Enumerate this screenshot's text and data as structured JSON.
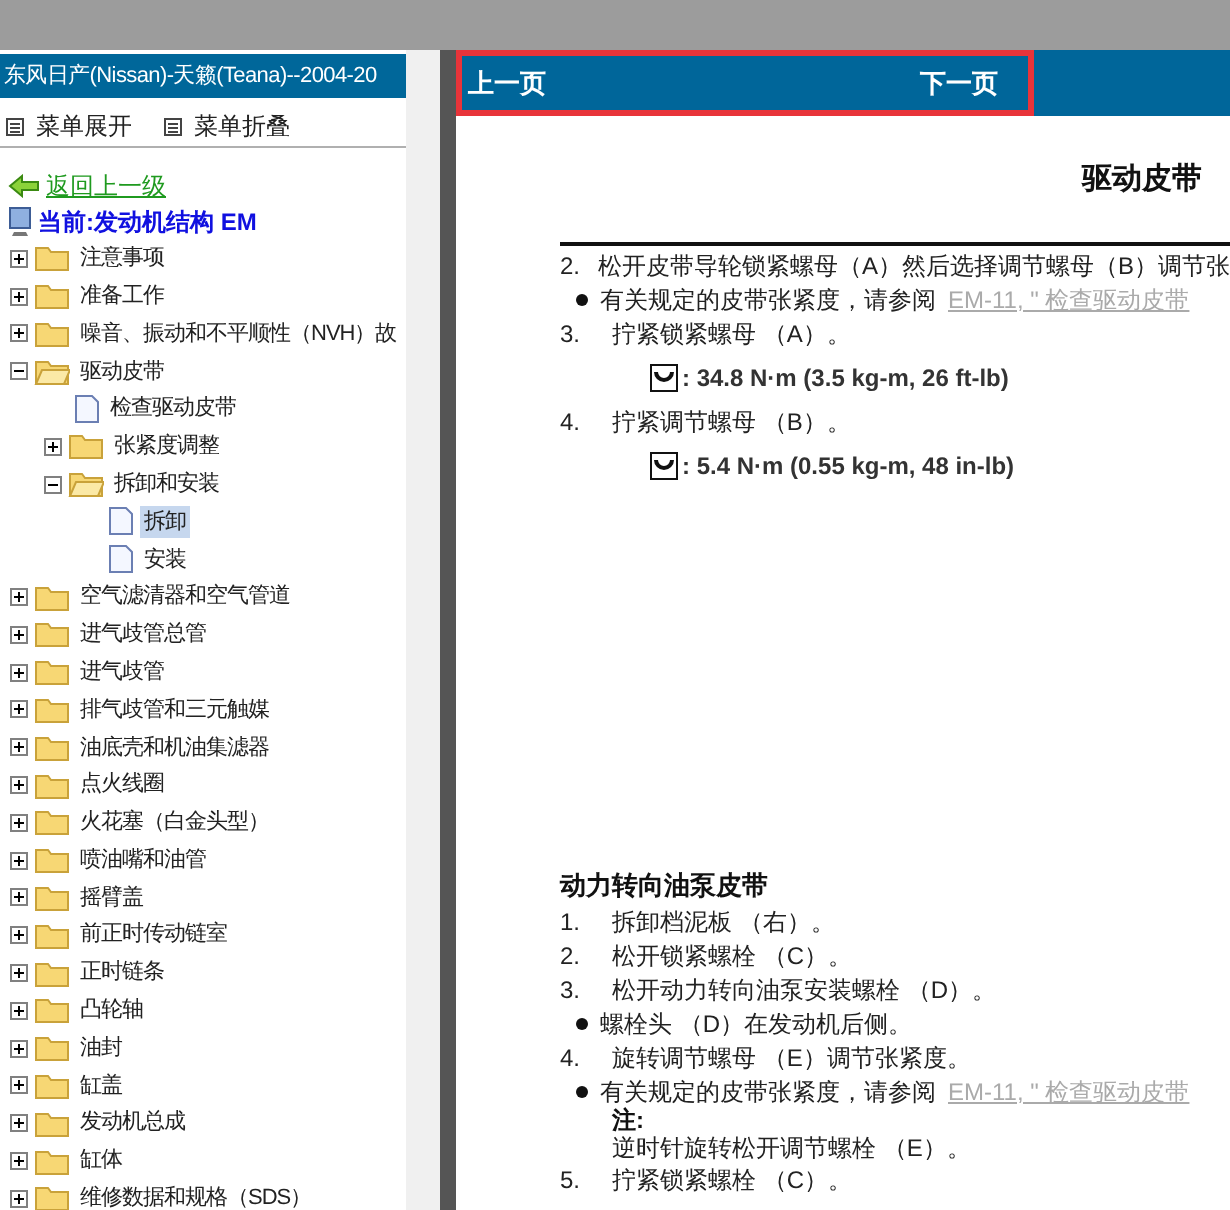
{
  "window": {
    "title": "东风日产(Nissan)-天籁(Teana)--2004-20"
  },
  "menu_buttons": [
    "菜单展开",
    "菜单折叠"
  ],
  "back_link": "返回上一级",
  "current": "当前:发动机结构 EM",
  "tree": [
    {
      "kind": "folder",
      "label": "注意事项",
      "expanded": false
    },
    {
      "kind": "folder",
      "label": "准备工作",
      "expanded": false
    },
    {
      "kind": "folder",
      "label": "噪音、振动和不平顺性（NVH）故",
      "expanded": false
    },
    {
      "kind": "folder",
      "label": "驱动皮带",
      "expanded": true,
      "children": [
        {
          "kind": "page",
          "label": "检查驱动皮带",
          "selected": false
        },
        {
          "kind": "folder",
          "label": "张紧度调整",
          "expanded": false
        },
        {
          "kind": "folder",
          "label": "拆卸和安装",
          "expanded": true,
          "children": [
            {
              "kind": "page",
              "label": "拆卸",
              "selected": true
            },
            {
              "kind": "page",
              "label": "安装",
              "selected": false
            }
          ]
        }
      ]
    },
    {
      "kind": "folder",
      "label": "空气滤清器和空气管道",
      "expanded": false
    },
    {
      "kind": "folder",
      "label": "进气歧管总管",
      "expanded": false
    },
    {
      "kind": "folder",
      "label": "进气歧管",
      "expanded": false
    },
    {
      "kind": "folder",
      "label": "排气歧管和三元触媒",
      "expanded": false
    },
    {
      "kind": "folder",
      "label": "油底壳和机油集滤器",
      "expanded": false
    },
    {
      "kind": "folder",
      "label": "点火线圈",
      "expanded": false
    },
    {
      "kind": "folder",
      "label": "火花塞（白金头型）",
      "expanded": false
    },
    {
      "kind": "folder",
      "label": "喷油嘴和油管",
      "expanded": false
    },
    {
      "kind": "folder",
      "label": "摇臂盖",
      "expanded": false
    },
    {
      "kind": "folder",
      "label": "前正时传动链室",
      "expanded": false
    },
    {
      "kind": "folder",
      "label": "正时链条",
      "expanded": false
    },
    {
      "kind": "folder",
      "label": "凸轮轴",
      "expanded": false
    },
    {
      "kind": "folder",
      "label": "油封",
      "expanded": false
    },
    {
      "kind": "folder",
      "label": "缸盖",
      "expanded": false
    },
    {
      "kind": "folder",
      "label": "发动机总成",
      "expanded": false
    },
    {
      "kind": "folder",
      "label": "缸体",
      "expanded": false
    },
    {
      "kind": "folder",
      "label": "维修数据和规格（SDS）",
      "expanded": false
    }
  ],
  "nav": {
    "prev": "上一页",
    "next": "下一页"
  },
  "document": {
    "title": "驱动皮带",
    "blocks": [
      {
        "kind": "step",
        "number": "2.",
        "text": "松开皮带导轮锁紧螺母（A）然后选择调节螺母（B）调节张"
      },
      {
        "kind": "bullet",
        "text": "有关规定的皮带张紧度，请参阅",
        "link": "EM-11, \" 检查驱动皮带"
      },
      {
        "kind": "step",
        "number": "3.",
        "text": "拧紧锁紧螺母 （A）。"
      },
      {
        "kind": "torque",
        "text": ": 34.8 N·m (3.5 kg-m, 26 ft-lb)"
      },
      {
        "kind": "step",
        "number": "4.",
        "text": "拧紧调节螺母 （B）。"
      },
      {
        "kind": "torque",
        "text": ": 5.4 N·m (0.55 kg-m, 48 in-lb)"
      },
      {
        "kind": "heading",
        "text": "动力转向油泵皮带"
      },
      {
        "kind": "step",
        "number": "1.",
        "text": "拆卸档泥板 （右）。"
      },
      {
        "kind": "step",
        "number": "2.",
        "text": "松开锁紧螺栓 （C）。"
      },
      {
        "kind": "step",
        "number": "3.",
        "text": "松开动力转向油泵安装螺栓 （D）。"
      },
      {
        "kind": "bullet",
        "text": "螺栓头 （D）在发动机后侧。"
      },
      {
        "kind": "step",
        "number": "4.",
        "text": "旋转调节螺母 （E）调节张紧度。"
      },
      {
        "kind": "bullet",
        "text": "有关规定的皮带张紧度，请参阅",
        "link": "EM-11, \" 检查驱动皮带"
      },
      {
        "kind": "note_label",
        "text": "注:"
      },
      {
        "kind": "note_text",
        "text": "逆时针旋转松开调节螺栓 （E）。"
      },
      {
        "kind": "step",
        "number": "5.",
        "text": "拧紧锁紧螺栓 （C）。"
      }
    ]
  }
}
